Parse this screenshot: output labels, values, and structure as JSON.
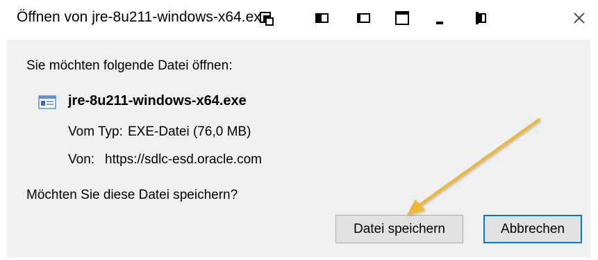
{
  "dialog": {
    "title": "Öffnen von jre-8u211-windows-x64.exe",
    "question": "Sie möchten folgende Datei öffnen:",
    "file": {
      "name": "jre-8u211-windows-x64.exe",
      "type_label": "Vom Typ:",
      "type_value": "EXE-Datei (76,0 MB)",
      "from_label": "Von:",
      "from_value": "https://sdlc-esd.oracle.com"
    },
    "save_question": "Möchten Sie diese Datei speichern?",
    "buttons": {
      "save": "Datei speichern",
      "cancel": "Abbrechen"
    }
  },
  "icons": {
    "file": "exe-file-icon",
    "close": "close-icon",
    "annotation": "arrow-annotation"
  },
  "colors": {
    "panel_bg": "#f0f0f0",
    "button_bg": "#e1e1e1",
    "default_border": "#0078d7",
    "annotation_arrow": "#f2b632"
  }
}
